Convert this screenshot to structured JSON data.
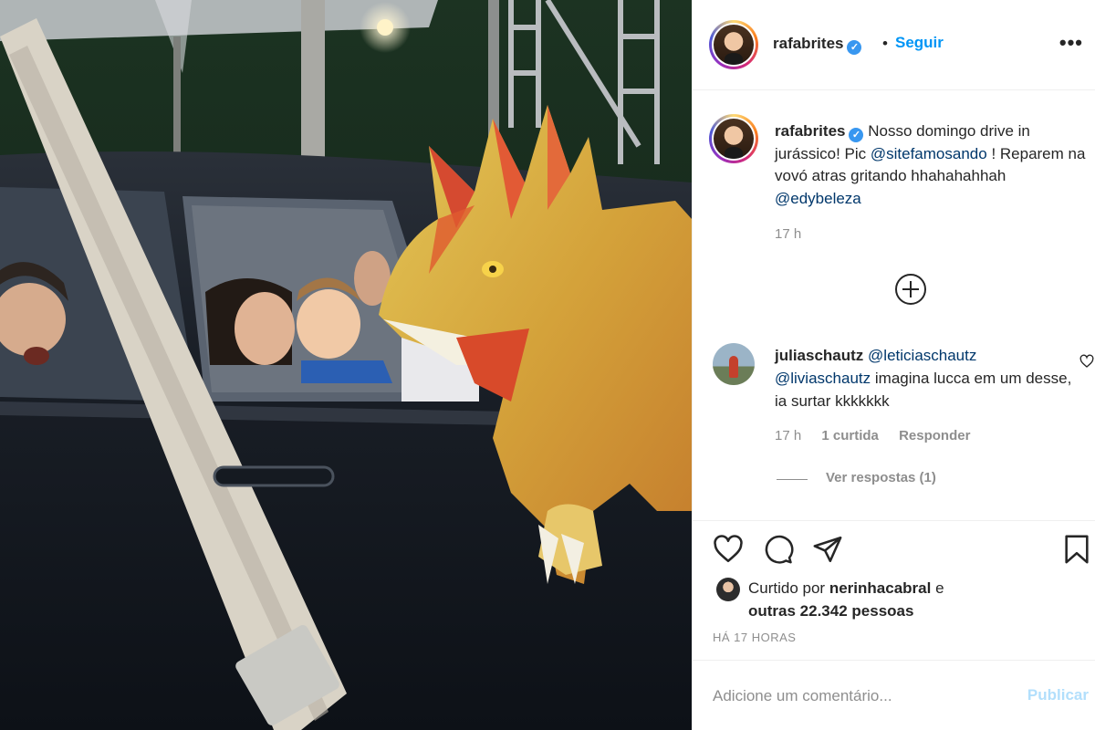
{
  "post": {
    "username": "rafabrites",
    "follow_label": "Seguir",
    "separator": "•",
    "more_label": "•••",
    "caption": {
      "username": "rafabrites",
      "text_1": "Nosso domingo drive in jurássico! Pic",
      "mention_1": "@sitefamosando",
      "text_2": "! Reparem na vovó atras gritando hhahahahhah",
      "mention_2": "@edybeleza",
      "time": "17 h"
    },
    "comment": {
      "username": "juliaschautz",
      "mention_1": "@leticiaschautz",
      "mention_2": "@liviaschautz",
      "text": "imagina lucca em um desse, ia surtar kkkkkkk",
      "time": "17 h",
      "likes": "1 curtida",
      "reply_label": "Responder",
      "view_replies": "Ver respostas (1)"
    },
    "likes": {
      "prefix": "Curtido por",
      "liked_by": "nerinhacabral",
      "conj": "e",
      "others": "outras 22.342 pessoas"
    },
    "posted_ago": "HÁ 17 HORAS",
    "comment_placeholder": "Adicione um comentário...",
    "publish_label": "Publicar"
  },
  "icons": {
    "verified": "verified-badge-icon",
    "like": "heart-icon",
    "comment": "comment-bubble-icon",
    "share": "paper-plane-icon",
    "save": "bookmark-icon",
    "load_more": "plus-circle-icon"
  },
  "colors": {
    "link_blue": "#0095f6",
    "mention_blue": "#00376b",
    "muted_text": "#8e8e8e",
    "publish_disabled": "#b2dffc",
    "verified_blue": "#3897f0"
  }
}
